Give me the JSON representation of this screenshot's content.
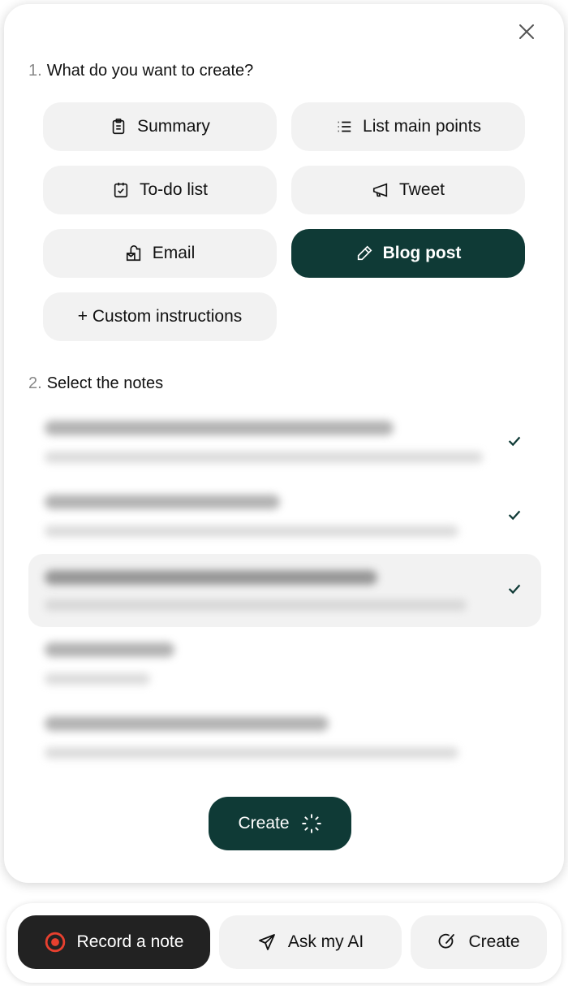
{
  "modal": {
    "step1": {
      "number": "1.",
      "label": "What do you want to create?"
    },
    "options": [
      {
        "label": "Summary",
        "icon": "clipboard-icon",
        "selected": false
      },
      {
        "label": "List main points",
        "icon": "list-icon",
        "selected": false
      },
      {
        "label": "To-do list",
        "icon": "clipboard-check-icon",
        "selected": false
      },
      {
        "label": "Tweet",
        "icon": "megaphone-icon",
        "selected": false
      },
      {
        "label": "Email",
        "icon": "mailbox-icon",
        "selected": false
      },
      {
        "label": "Blog post",
        "icon": "pencil-icon",
        "selected": true
      },
      {
        "label": "+ Custom instructions",
        "icon": "",
        "selected": false
      }
    ],
    "step2": {
      "number": "2.",
      "label": "Select the notes"
    },
    "notes": [
      {
        "checked": true,
        "highlighted": false
      },
      {
        "checked": true,
        "highlighted": false
      },
      {
        "checked": true,
        "highlighted": true
      },
      {
        "checked": false,
        "highlighted": false
      },
      {
        "checked": false,
        "highlighted": false
      }
    ],
    "create_label": "Create"
  },
  "dock": {
    "record": "Record a note",
    "ask": "Ask my AI",
    "create": "Create"
  },
  "colors": {
    "accent": "#0f3a36",
    "record": "#e8402f",
    "dark": "#222222"
  }
}
